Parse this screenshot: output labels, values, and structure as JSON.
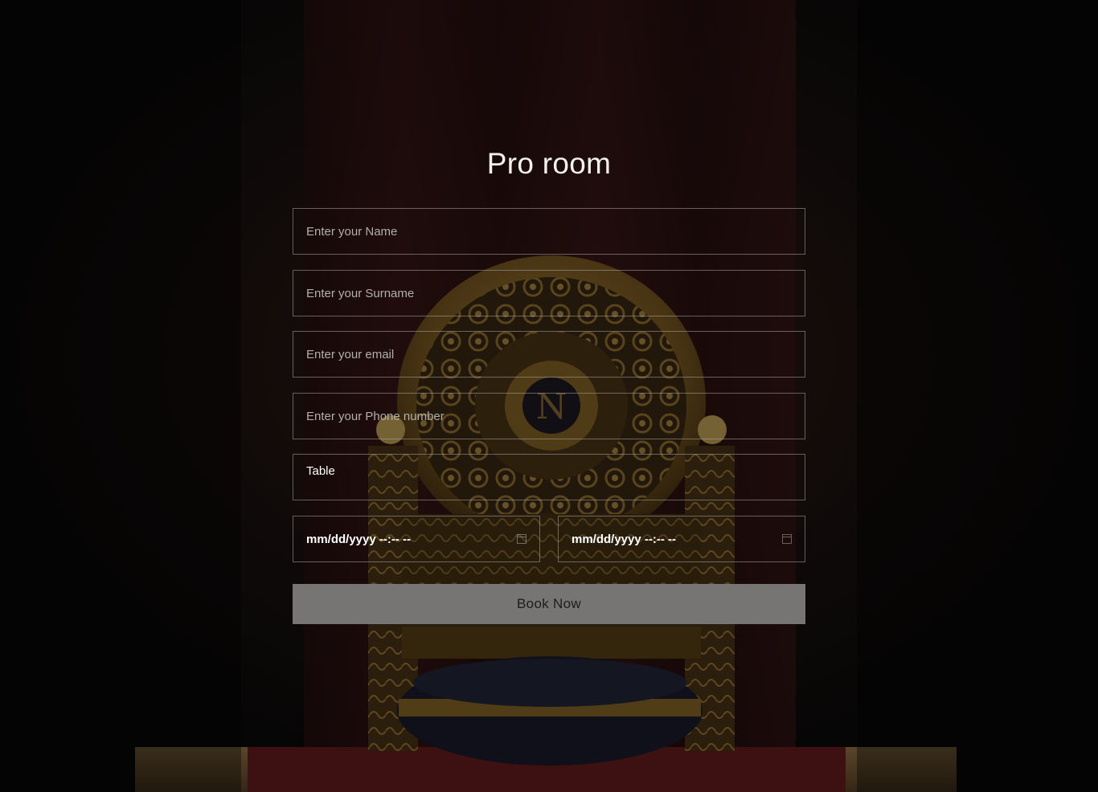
{
  "page": {
    "title": "Pro room"
  },
  "form": {
    "name_placeholder": "Enter your Name",
    "surname_placeholder": "Enter your Surname",
    "email_placeholder": "Enter your email",
    "phone_placeholder": "Enter your Phone number",
    "table_value": "Table",
    "checkin_value": "mm/dd/yyyy --:-- --",
    "checkout_value": "mm/dd/yyyy --:-- --",
    "submit_label": "Book Now"
  },
  "colors": {
    "background": "#0f0d0c",
    "button": "#777574",
    "field_border": "#aaa5a0",
    "gold": "#8a6a2a"
  }
}
